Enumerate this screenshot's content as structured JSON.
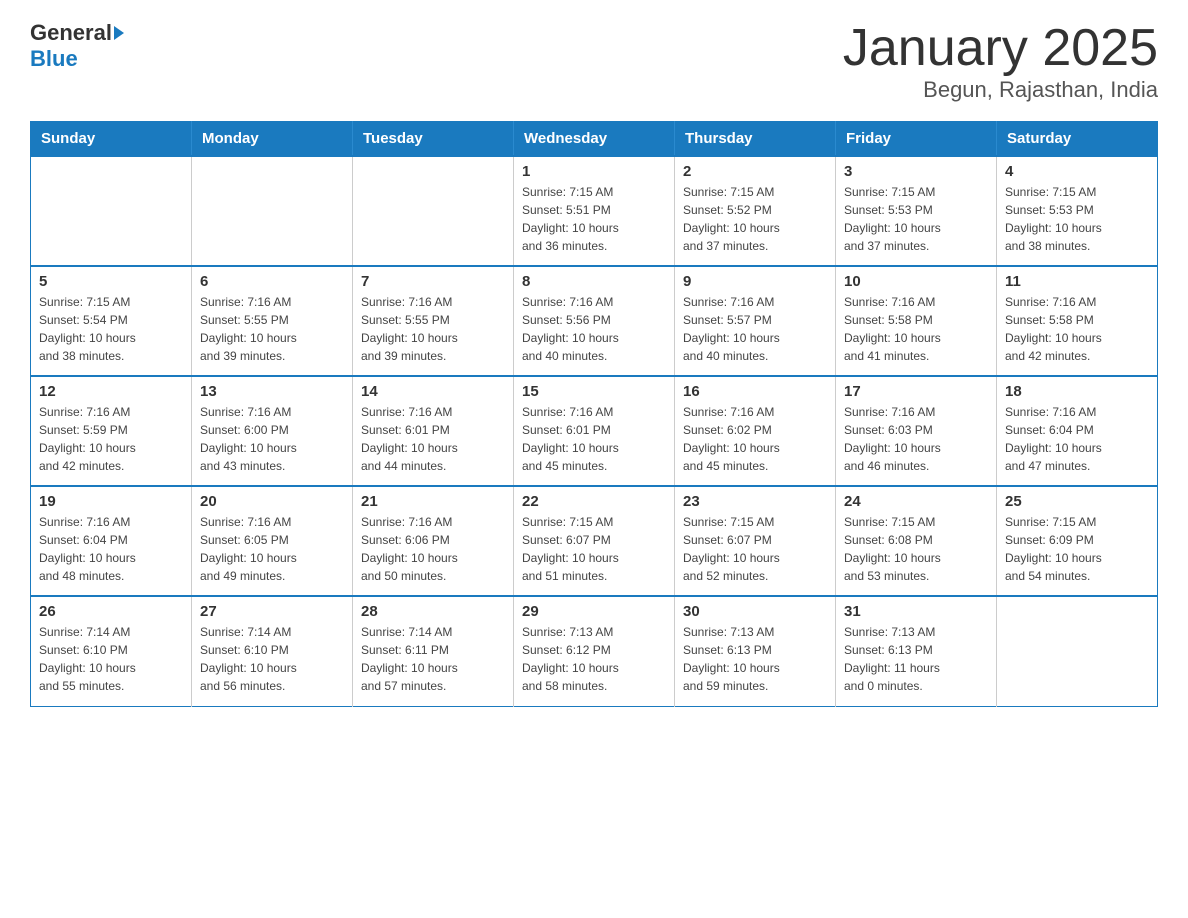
{
  "header": {
    "logo_general": "General",
    "logo_blue": "Blue",
    "title": "January 2025",
    "subtitle": "Begun, Rajasthan, India"
  },
  "days_of_week": [
    "Sunday",
    "Monday",
    "Tuesday",
    "Wednesday",
    "Thursday",
    "Friday",
    "Saturday"
  ],
  "weeks": [
    [
      {
        "day": "",
        "info": ""
      },
      {
        "day": "",
        "info": ""
      },
      {
        "day": "",
        "info": ""
      },
      {
        "day": "1",
        "info": "Sunrise: 7:15 AM\nSunset: 5:51 PM\nDaylight: 10 hours\nand 36 minutes."
      },
      {
        "day": "2",
        "info": "Sunrise: 7:15 AM\nSunset: 5:52 PM\nDaylight: 10 hours\nand 37 minutes."
      },
      {
        "day": "3",
        "info": "Sunrise: 7:15 AM\nSunset: 5:53 PM\nDaylight: 10 hours\nand 37 minutes."
      },
      {
        "day": "4",
        "info": "Sunrise: 7:15 AM\nSunset: 5:53 PM\nDaylight: 10 hours\nand 38 minutes."
      }
    ],
    [
      {
        "day": "5",
        "info": "Sunrise: 7:15 AM\nSunset: 5:54 PM\nDaylight: 10 hours\nand 38 minutes."
      },
      {
        "day": "6",
        "info": "Sunrise: 7:16 AM\nSunset: 5:55 PM\nDaylight: 10 hours\nand 39 minutes."
      },
      {
        "day": "7",
        "info": "Sunrise: 7:16 AM\nSunset: 5:55 PM\nDaylight: 10 hours\nand 39 minutes."
      },
      {
        "day": "8",
        "info": "Sunrise: 7:16 AM\nSunset: 5:56 PM\nDaylight: 10 hours\nand 40 minutes."
      },
      {
        "day": "9",
        "info": "Sunrise: 7:16 AM\nSunset: 5:57 PM\nDaylight: 10 hours\nand 40 minutes."
      },
      {
        "day": "10",
        "info": "Sunrise: 7:16 AM\nSunset: 5:58 PM\nDaylight: 10 hours\nand 41 minutes."
      },
      {
        "day": "11",
        "info": "Sunrise: 7:16 AM\nSunset: 5:58 PM\nDaylight: 10 hours\nand 42 minutes."
      }
    ],
    [
      {
        "day": "12",
        "info": "Sunrise: 7:16 AM\nSunset: 5:59 PM\nDaylight: 10 hours\nand 42 minutes."
      },
      {
        "day": "13",
        "info": "Sunrise: 7:16 AM\nSunset: 6:00 PM\nDaylight: 10 hours\nand 43 minutes."
      },
      {
        "day": "14",
        "info": "Sunrise: 7:16 AM\nSunset: 6:01 PM\nDaylight: 10 hours\nand 44 minutes."
      },
      {
        "day": "15",
        "info": "Sunrise: 7:16 AM\nSunset: 6:01 PM\nDaylight: 10 hours\nand 45 minutes."
      },
      {
        "day": "16",
        "info": "Sunrise: 7:16 AM\nSunset: 6:02 PM\nDaylight: 10 hours\nand 45 minutes."
      },
      {
        "day": "17",
        "info": "Sunrise: 7:16 AM\nSunset: 6:03 PM\nDaylight: 10 hours\nand 46 minutes."
      },
      {
        "day": "18",
        "info": "Sunrise: 7:16 AM\nSunset: 6:04 PM\nDaylight: 10 hours\nand 47 minutes."
      }
    ],
    [
      {
        "day": "19",
        "info": "Sunrise: 7:16 AM\nSunset: 6:04 PM\nDaylight: 10 hours\nand 48 minutes."
      },
      {
        "day": "20",
        "info": "Sunrise: 7:16 AM\nSunset: 6:05 PM\nDaylight: 10 hours\nand 49 minutes."
      },
      {
        "day": "21",
        "info": "Sunrise: 7:16 AM\nSunset: 6:06 PM\nDaylight: 10 hours\nand 50 minutes."
      },
      {
        "day": "22",
        "info": "Sunrise: 7:15 AM\nSunset: 6:07 PM\nDaylight: 10 hours\nand 51 minutes."
      },
      {
        "day": "23",
        "info": "Sunrise: 7:15 AM\nSunset: 6:07 PM\nDaylight: 10 hours\nand 52 minutes."
      },
      {
        "day": "24",
        "info": "Sunrise: 7:15 AM\nSunset: 6:08 PM\nDaylight: 10 hours\nand 53 minutes."
      },
      {
        "day": "25",
        "info": "Sunrise: 7:15 AM\nSunset: 6:09 PM\nDaylight: 10 hours\nand 54 minutes."
      }
    ],
    [
      {
        "day": "26",
        "info": "Sunrise: 7:14 AM\nSunset: 6:10 PM\nDaylight: 10 hours\nand 55 minutes."
      },
      {
        "day": "27",
        "info": "Sunrise: 7:14 AM\nSunset: 6:10 PM\nDaylight: 10 hours\nand 56 minutes."
      },
      {
        "day": "28",
        "info": "Sunrise: 7:14 AM\nSunset: 6:11 PM\nDaylight: 10 hours\nand 57 minutes."
      },
      {
        "day": "29",
        "info": "Sunrise: 7:13 AM\nSunset: 6:12 PM\nDaylight: 10 hours\nand 58 minutes."
      },
      {
        "day": "30",
        "info": "Sunrise: 7:13 AM\nSunset: 6:13 PM\nDaylight: 10 hours\nand 59 minutes."
      },
      {
        "day": "31",
        "info": "Sunrise: 7:13 AM\nSunset: 6:13 PM\nDaylight: 11 hours\nand 0 minutes."
      },
      {
        "day": "",
        "info": ""
      }
    ]
  ]
}
